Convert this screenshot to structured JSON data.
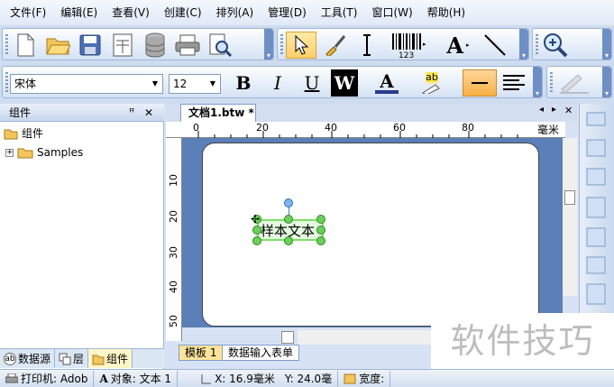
{
  "menu": [
    "文件(F)",
    "编辑(E)",
    "查看(V)",
    "创建(C)",
    "排列(A)",
    "管理(D)",
    "工具(T)",
    "窗口(W)",
    "帮助(H)"
  ],
  "toolbar_icons": {
    "standard": [
      "new-document-icon",
      "open-folder-icon",
      "save-icon",
      "page-setup-icon",
      "database-icon",
      "print-icon",
      "print-preview-icon"
    ],
    "tools": [
      "pointer-icon",
      "brush-icon",
      "text-cursor-icon",
      "barcode-icon",
      "text-a-icon",
      "line-icon"
    ],
    "zoom": [
      "zoom-icon"
    ]
  },
  "barcode_digits": "123",
  "format": {
    "font": "宋体",
    "size": "12",
    "bold": "B",
    "italic": "I",
    "underline": "U",
    "outline": "W",
    "font_color_letter": "A",
    "highlight_letters": "ab"
  },
  "panel": {
    "title": "组件",
    "pin": "ꟸ",
    "close": "✕",
    "root": "组件",
    "child": "Samples",
    "tabs": [
      "数据源",
      "层",
      "组件"
    ]
  },
  "document": {
    "tab": "文档1.btw *",
    "unit": "毫米",
    "hruler": [
      "0",
      "20",
      "40",
      "60",
      "80"
    ],
    "vruler": [
      "10",
      "20",
      "30",
      "40",
      "50"
    ],
    "sample_text": "样本文本",
    "bottom_tabs": [
      "模板 1",
      "数据输入表单"
    ],
    "nav": [
      "◂",
      "▸",
      "✕"
    ]
  },
  "status": {
    "printer": "打印机: Adob",
    "object": "对象: 文本 1",
    "x": "X: 16.9毫米",
    "y": "Y: 24.0毫",
    "width": "宽度:"
  },
  "watermark": "软件技巧",
  "colors": {
    "selection_green": "#6ccf5a",
    "accent_blue": "#5b7fb8",
    "orange_button": "#f7b045"
  }
}
